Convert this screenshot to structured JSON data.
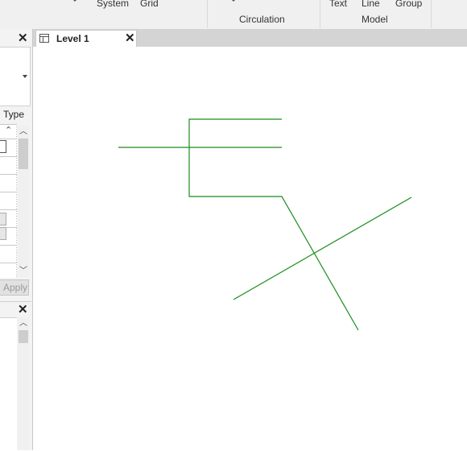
{
  "ribbon": {
    "system_label": "System",
    "grid_label": "Grid",
    "circulation_label": "Circulation",
    "text_label": "Text",
    "line_label": "Line",
    "group_label": "Group",
    "model_label": "Model"
  },
  "properties_panel": {
    "type_label": "Type",
    "apply_label": "Apply"
  },
  "view_tab": {
    "label": "Level 1"
  },
  "colors": {
    "model_line": "#1a8c1a",
    "ribbon_bg": "#f0f0f0",
    "tabbar_bg": "#d4d4d4"
  },
  "icons": {
    "tab_view_icon": "plan-view-icon",
    "close": "close-icon",
    "dropdown": "chevron-down-icon",
    "collapse": "double-chevron-up-icon"
  }
}
